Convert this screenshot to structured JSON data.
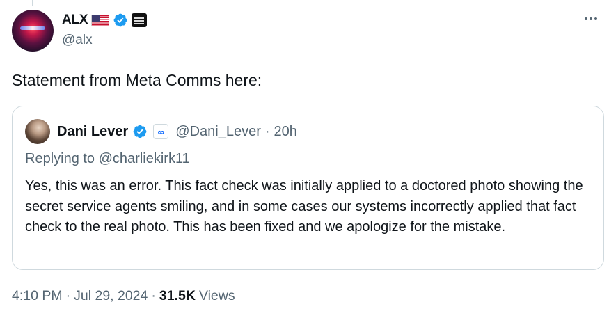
{
  "author": {
    "display_name": "ALX",
    "handle": "@alx",
    "flag_icon": "us-flag-icon",
    "verified_color": "#1d9bf0"
  },
  "tweet": {
    "text": "Statement from Meta Comms here:"
  },
  "quote": {
    "display_name": "Dani Lever",
    "affiliate": "∞",
    "handle": "@Dani_Lever",
    "separator": "·",
    "time": "20h",
    "replying_label": "Replying to",
    "replying_to": "@charliekirk11",
    "body": "Yes, this was an error. This fact check was initially applied to a doctored photo showing the secret service agents smiling, and in some cases our systems incorrectly applied that fact check to the real photo. This has been fixed and we apologize for the mistake."
  },
  "footer": {
    "time": "4:10 PM",
    "sep1": "·",
    "date": "Jul 29, 2024",
    "sep2": "·",
    "views_count": "31.5K",
    "views_label": "Views"
  },
  "colors": {
    "accent": "#1d9bf0",
    "secondary_text": "#536471",
    "border": "#cfd9de"
  }
}
